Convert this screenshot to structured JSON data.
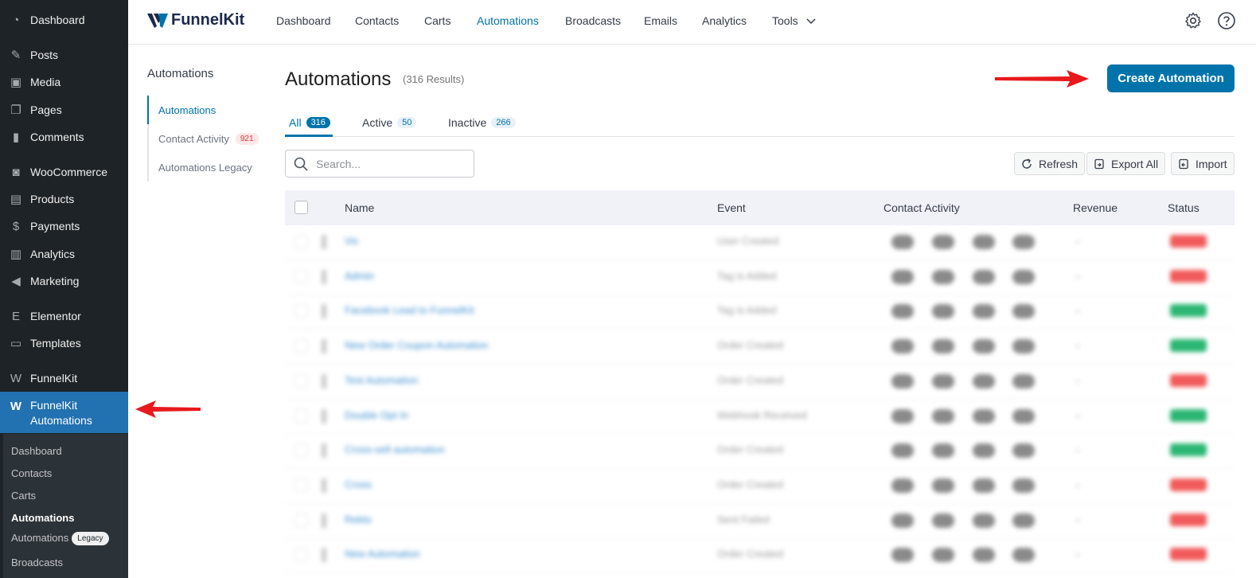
{
  "wp_menu": {
    "items": [
      {
        "label": "Dashboard",
        "icon": "dashboard-icon",
        "glyph": "◔"
      },
      {
        "label": "Posts",
        "icon": "pin-icon",
        "glyph": "✎"
      },
      {
        "label": "Media",
        "icon": "media-icon",
        "glyph": "▣"
      },
      {
        "label": "Pages",
        "icon": "pages-icon",
        "glyph": "❐"
      },
      {
        "label": "Comments",
        "icon": "comment-icon",
        "glyph": "▮"
      },
      {
        "label": "WooCommerce",
        "icon": "woo-icon",
        "glyph": "◙"
      },
      {
        "label": "Products",
        "icon": "products-icon",
        "glyph": "▤"
      },
      {
        "label": "Payments",
        "icon": "payments-icon",
        "glyph": "$"
      },
      {
        "label": "Analytics",
        "icon": "analytics-icon",
        "glyph": "▥"
      },
      {
        "label": "Marketing",
        "icon": "megaphone-icon",
        "glyph": "◀"
      },
      {
        "label": "Elementor",
        "icon": "elementor-icon",
        "glyph": "E"
      },
      {
        "label": "Templates",
        "icon": "folder-icon",
        "glyph": "▭"
      },
      {
        "label": "FunnelKit",
        "icon": "funnelkit-icon",
        "glyph": "W"
      }
    ],
    "active": {
      "label_line1": "FunnelKit",
      "label_line2": "Automations",
      "icon": "funnelkit-icon",
      "glyph": "W"
    },
    "submenu": [
      {
        "label": "Dashboard"
      },
      {
        "label": "Contacts"
      },
      {
        "label": "Carts"
      },
      {
        "label": "Automations",
        "current": true
      },
      {
        "label": "Automations",
        "pill": "Legacy"
      },
      {
        "label": "Broadcasts"
      }
    ]
  },
  "topbar": {
    "logo_text": "FunnelKit",
    "nav": [
      "Dashboard",
      "Contacts",
      "Carts",
      "Automations",
      "Broadcasts",
      "Emails",
      "Analytics",
      "Tools"
    ],
    "active_nav": "Automations"
  },
  "subnav": {
    "title": "Automations",
    "items": [
      {
        "label": "Automations"
      },
      {
        "label": "Contact Activity",
        "count": "921"
      },
      {
        "label": "Automations Legacy"
      }
    ]
  },
  "main": {
    "title": "Automations",
    "results": "(316 Results)",
    "create_button": "Create Automation",
    "tabs": [
      {
        "label": "All",
        "count": "316"
      },
      {
        "label": "Active",
        "count": "50"
      },
      {
        "label": "Inactive",
        "count": "266"
      }
    ],
    "search_placeholder": "Search...",
    "buttons": {
      "refresh": "Refresh",
      "export": "Export All",
      "import": "Import"
    },
    "columns": [
      "Name",
      "Event",
      "Contact Activity",
      "Revenue",
      "Status"
    ]
  },
  "colors": {
    "accent": "#0073aa",
    "wp_active": "#2271b1",
    "arrow": "#e8191c",
    "status_active": "#2bb673",
    "status_inactive": "#f15a5a"
  },
  "rows": [
    {
      "name": "Vic",
      "event": "User Created",
      "status": "inactive"
    },
    {
      "name": "Admin",
      "event": "Tag is Added",
      "status": "inactive"
    },
    {
      "name": "Facebook Lead to FunnelKit",
      "event": "Tag is Added",
      "status": "active"
    },
    {
      "name": "New Order Coupon Automation",
      "event": "Order Created",
      "status": "active"
    },
    {
      "name": "Test Automation",
      "event": "Order Created",
      "status": "inactive"
    },
    {
      "name": "Double Opt In",
      "event": "Webhook Received",
      "status": "active"
    },
    {
      "name": "Cross-sell automation",
      "event": "Order Created",
      "status": "active"
    },
    {
      "name": "Cross",
      "event": "Order Created",
      "status": "inactive"
    },
    {
      "name": "Rekto",
      "event": "Sent Failed",
      "status": "inactive"
    },
    {
      "name": "New Automation",
      "event": "Order Created",
      "status": "inactive"
    }
  ]
}
